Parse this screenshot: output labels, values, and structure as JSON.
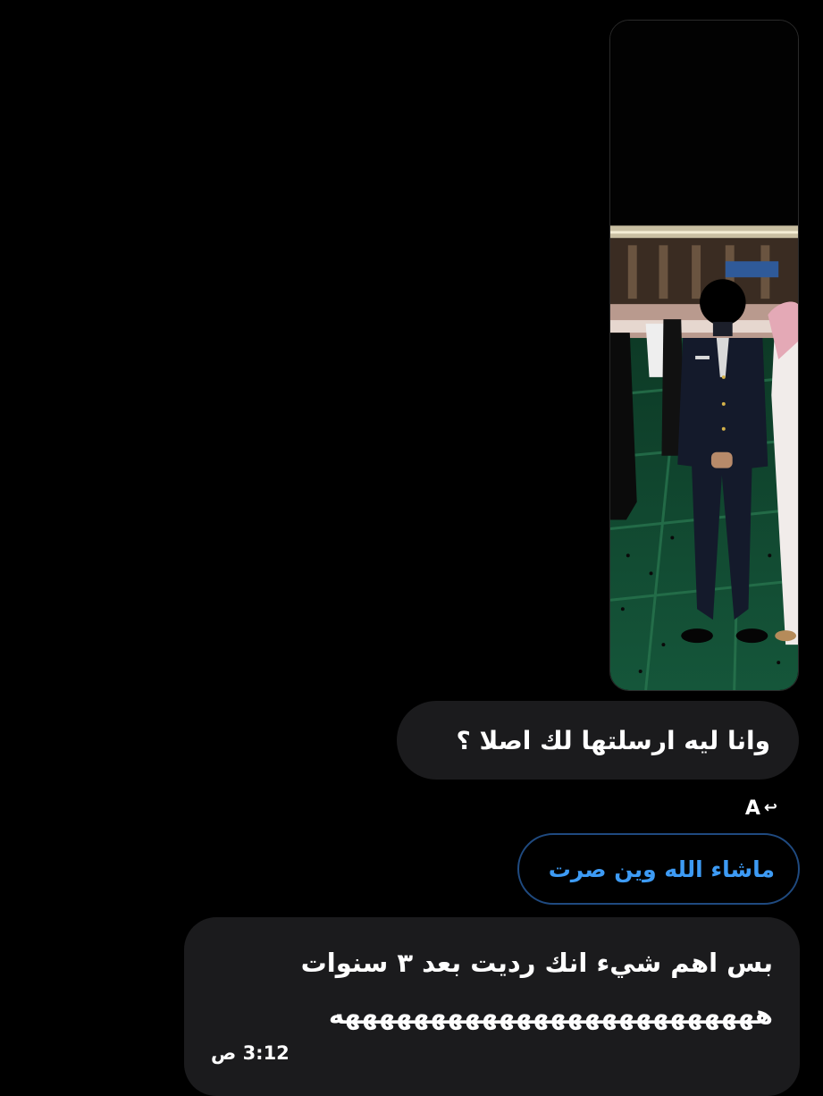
{
  "conversation": {
    "photo_icon": "photo-attachment",
    "message_1": "وانا ليه ارسلتها لك اصلا ؟",
    "reply": {
      "icon": "reply-arrow-icon",
      "sender_initial": "A"
    },
    "quoted_message": "ماشاء الله وين صرت",
    "message_2": {
      "line_1": "بس اهم شيء انك رديت بعد ٣ سنوات",
      "line_2": "هههههههههههههههههههههههههه"
    },
    "timestamp": "3:12 ص"
  },
  "colors": {
    "background": "#000000",
    "bubble": "#1b1b1d",
    "quoted_text": "#3d9bf5",
    "quoted_border": "#1f4a80"
  }
}
